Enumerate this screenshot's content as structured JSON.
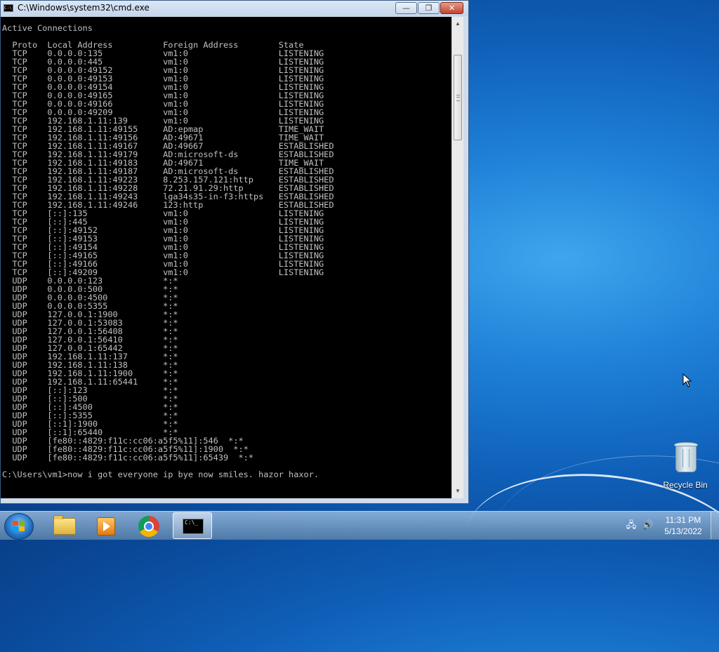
{
  "window": {
    "title": "C:\\Windows\\system32\\cmd.exe",
    "app_icon_text": "C:\\",
    "minimize_glyph": "—",
    "maximize_glyph": "❐",
    "close_glyph": "✕"
  },
  "console": {
    "lines": [
      "Active Connections",
      "",
      "  Proto  Local Address          Foreign Address        State",
      "  TCP    0.0.0.0:135            vm1:0                  LISTENING",
      "  TCP    0.0.0.0:445            vm1:0                  LISTENING",
      "  TCP    0.0.0.0:49152          vm1:0                  LISTENING",
      "  TCP    0.0.0.0:49153          vm1:0                  LISTENING",
      "  TCP    0.0.0.0:49154          vm1:0                  LISTENING",
      "  TCP    0.0.0.0:49165          vm1:0                  LISTENING",
      "  TCP    0.0.0.0:49166          vm1:0                  LISTENING",
      "  TCP    0.0.0.0:49209          vm1:0                  LISTENING",
      "  TCP    192.168.1.11:139       vm1:0                  LISTENING",
      "  TCP    192.168.1.11:49155     AD:epmap               TIME_WAIT",
      "  TCP    192.168.1.11:49156     AD:49671               TIME_WAIT",
      "  TCP    192.168.1.11:49167     AD:49667               ESTABLISHED",
      "  TCP    192.168.1.11:49179     AD:microsoft-ds        ESTABLISHED",
      "  TCP    192.168.1.11:49183     AD:49671               TIME_WAIT",
      "  TCP    192.168.1.11:49187     AD:microsoft-ds        ESTABLISHED",
      "  TCP    192.168.1.11:49223     8.253.157.121:http     ESTABLISHED",
      "  TCP    192.168.1.11:49228     72.21.91.29:http       ESTABLISHED",
      "  TCP    192.168.1.11:49243     lga34s35-in-f3:https   ESTABLISHED",
      "  TCP    192.168.1.11:49246     123:http               ESTABLISHED",
      "  TCP    [::]:135               vm1:0                  LISTENING",
      "  TCP    [::]:445               vm1:0                  LISTENING",
      "  TCP    [::]:49152             vm1:0                  LISTENING",
      "  TCP    [::]:49153             vm1:0                  LISTENING",
      "  TCP    [::]:49154             vm1:0                  LISTENING",
      "  TCP    [::]:49165             vm1:0                  LISTENING",
      "  TCP    [::]:49166             vm1:0                  LISTENING",
      "  TCP    [::]:49209             vm1:0                  LISTENING",
      "  UDP    0.0.0.0:123            *:*",
      "  UDP    0.0.0.0:500            *:*",
      "  UDP    0.0.0.0:4500           *:*",
      "  UDP    0.0.0.0:5355           *:*",
      "  UDP    127.0.0.1:1900         *:*",
      "  UDP    127.0.0.1:53083        *:*",
      "  UDP    127.0.0.1:56408        *:*",
      "  UDP    127.0.0.1:56410        *:*",
      "  UDP    127.0.0.1:65442        *:*",
      "  UDP    192.168.1.11:137       *:*",
      "  UDP    192.168.1.11:138       *:*",
      "  UDP    192.168.1.11:1900      *:*",
      "  UDP    192.168.1.11:65441     *:*",
      "  UDP    [::]:123               *:*",
      "  UDP    [::]:500               *:*",
      "  UDP    [::]:4500              *:*",
      "  UDP    [::]:5355              *:*",
      "  UDP    [::1]:1900             *:*",
      "  UDP    [::1]:65440            *:*",
      "  UDP    [fe80::4829:f11c:cc06:a5f5%11]:546  *:*",
      "  UDP    [fe80::4829:f11c:cc06:a5f5%11]:1900  *:*",
      "  UDP    [fe80::4829:f11c:cc06:a5f5%11]:65439  *:*",
      "",
      "C:\\Users\\vm1>now i got everyone ip bye now smiles. hazor haxor."
    ]
  },
  "scrollbar": {
    "up_glyph": "▲",
    "down_glyph": "▼",
    "position_fraction": 0.0
  },
  "desktop": {
    "icons": [
      {
        "label": "Recycle Bin",
        "icon": "recycle-bin-icon"
      }
    ]
  },
  "taskbar": {
    "pinned": [
      {
        "name": "windows-explorer",
        "icon": "folder-icon",
        "active": false
      },
      {
        "name": "windows-media-player",
        "icon": "media-player-icon",
        "active": false
      },
      {
        "name": "google-chrome",
        "icon": "chrome-icon",
        "active": false
      },
      {
        "name": "command-prompt",
        "icon": "cmd-icon",
        "active": true,
        "icon_text": "C:\\_"
      }
    ],
    "tray": {
      "network_glyph": "🖧",
      "volume_glyph": "🔊",
      "time": "11:31 PM",
      "date": "5/13/2022"
    }
  }
}
